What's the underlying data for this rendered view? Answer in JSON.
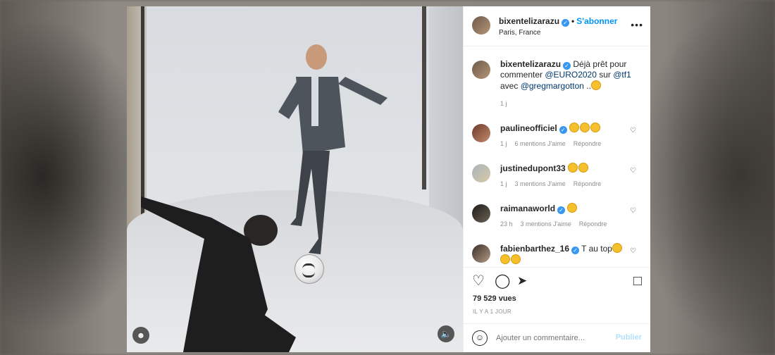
{
  "post": {
    "username": "bixentelizarazu",
    "follow_label": "S'abonner",
    "location": "Paris, France",
    "more_label": "•••"
  },
  "caption": {
    "username": "bixentelizarazu",
    "text_1": "Déjà prêt pour commenter ",
    "mention_1": "@EURO2020",
    "text_2": " sur ",
    "mention_2": "@tf1",
    "text_3": " avec ",
    "mention_3": "@gregmargotton",
    "text_4": " ..",
    "time": "1 j"
  },
  "comments": [
    {
      "username": "paulineofficiel",
      "text": "",
      "emoji_count": 3,
      "time": "1 j",
      "likes": "6 mentions J'aime",
      "reply": "Répondre"
    },
    {
      "username": "justinedupont33",
      "text": "",
      "emoji_count": 2,
      "time": "1 j",
      "likes": "3 mentions J'aime",
      "reply": "Répondre"
    },
    {
      "username": "raimanaworld",
      "text": "",
      "emoji_count": 1,
      "time": "23 h",
      "likes": "3 mentions J'aime",
      "reply": "Répondre"
    },
    {
      "username": "fabienbarthez_16",
      "text": "T au top",
      "emoji_count": 3,
      "time": "",
      "likes": "",
      "reply": ""
    }
  ],
  "stats": {
    "views": "79 529 vues",
    "ago": "IL Y A 1 JOUR"
  },
  "add_comment": {
    "placeholder": "Ajouter un commentaire...",
    "post_label": "Publier"
  },
  "icons": {
    "like": "heart-icon",
    "comment": "comment-icon",
    "share": "paper-plane-icon",
    "save": "bookmark-icon",
    "emoji": "smiley-icon",
    "sound": "speaker-icon",
    "user": "user-tag-icon"
  },
  "colors": {
    "link_blue": "#0095f6",
    "verified_blue": "#3897f0",
    "mention": "#00376b",
    "muted": "#8e8e8e",
    "post_disabled": "#b2dffc"
  }
}
